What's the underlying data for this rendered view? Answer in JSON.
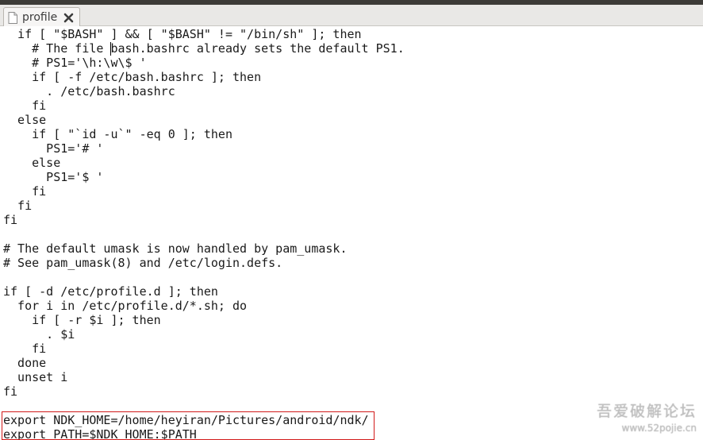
{
  "tab": {
    "label": "profile",
    "icon": "document-icon",
    "close_icon": "close-icon"
  },
  "editor": {
    "lines": [
      "  if [ \"$BASH\" ] && [ \"$BASH\" != \"/bin/sh\" ]; then",
      "    # The file bash.bashrc already sets the default PS1.",
      "    # PS1='\\h:\\w\\$ '",
      "    if [ -f /etc/bash.bashrc ]; then",
      "      . /etc/bash.bashrc",
      "    fi",
      "  else",
      "    if [ \"`id -u`\" -eq 0 ]; then",
      "      PS1='# '",
      "    else",
      "      PS1='$ '",
      "    fi",
      "  fi",
      "fi",
      "",
      "# The default umask is now handled by pam_umask.",
      "# See pam_umask(8) and /etc/login.defs.",
      "",
      "if [ -d /etc/profile.d ]; then",
      "  for i in /etc/profile.d/*.sh; do",
      "    if [ -r $i ]; then",
      "      . $i",
      "    fi",
      "  done",
      "  unset i",
      "fi",
      "",
      "export NDK_HOME=/home/heyiran/Pictures/android/ndk/",
      "export PATH=$NDK_HOME:$PATH"
    ]
  },
  "watermark": {
    "title": "吾爱破解论坛",
    "url": "www.52pojie.cn"
  },
  "colors": {
    "highlight_border": "#d21a1a",
    "tabbar_bg": "#e9e8e6",
    "text": "#1a1a1a"
  }
}
